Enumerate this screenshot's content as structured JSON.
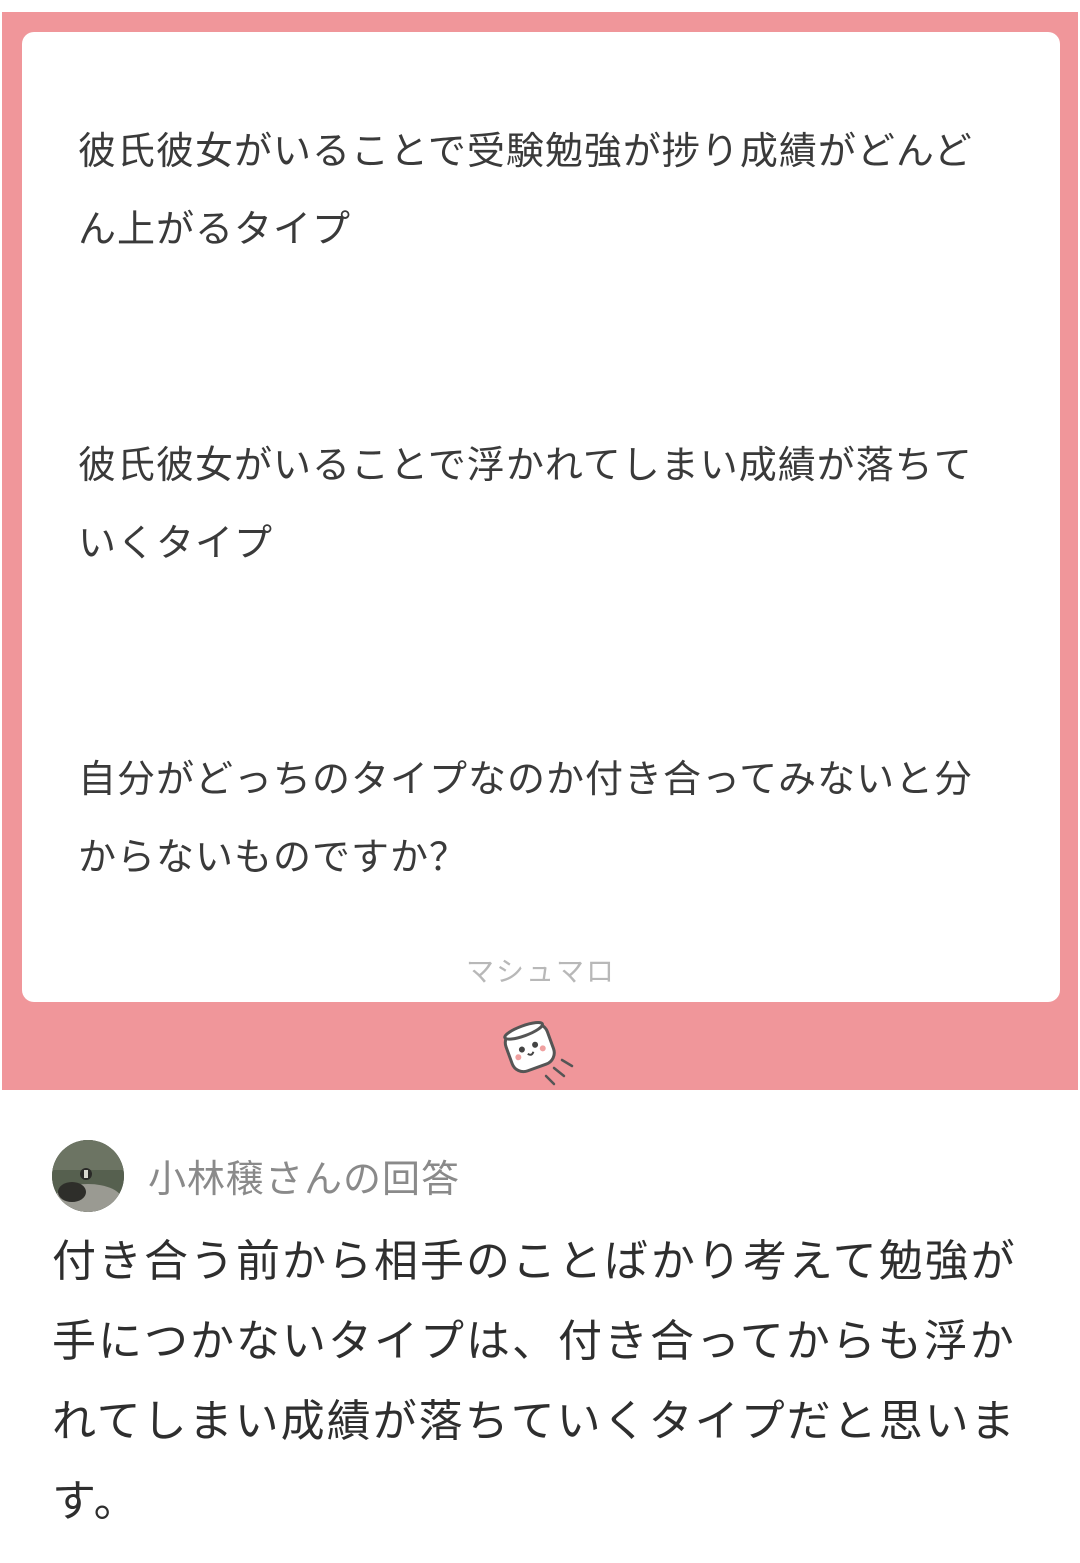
{
  "question": {
    "paragraphs": [
      "彼氏彼女がいることで受験勉強が捗り成績がどんどん上がるタイプ",
      "彼氏彼女がいることで浮かれてしまい成績が落ちていくタイプ",
      "自分がどっちのタイプなのか付き合ってみないと分からないものですか？"
    ],
    "brand": "マシュマロ",
    "mascot_icon": "marshmallow-mascot-icon"
  },
  "answer": {
    "answerer_label": "小林穣さんの回答",
    "text": "付き合う前から相手のことばかり考えて勉強が手につかないタイプは、付き合ってからも浮かれてしまい成績が落ちていくタイプだと思います。"
  },
  "colors": {
    "panel": "#f0969a",
    "card": "#ffffff",
    "brand_text": "#b8b8b8",
    "answerer_text": "#8a8a8a"
  }
}
